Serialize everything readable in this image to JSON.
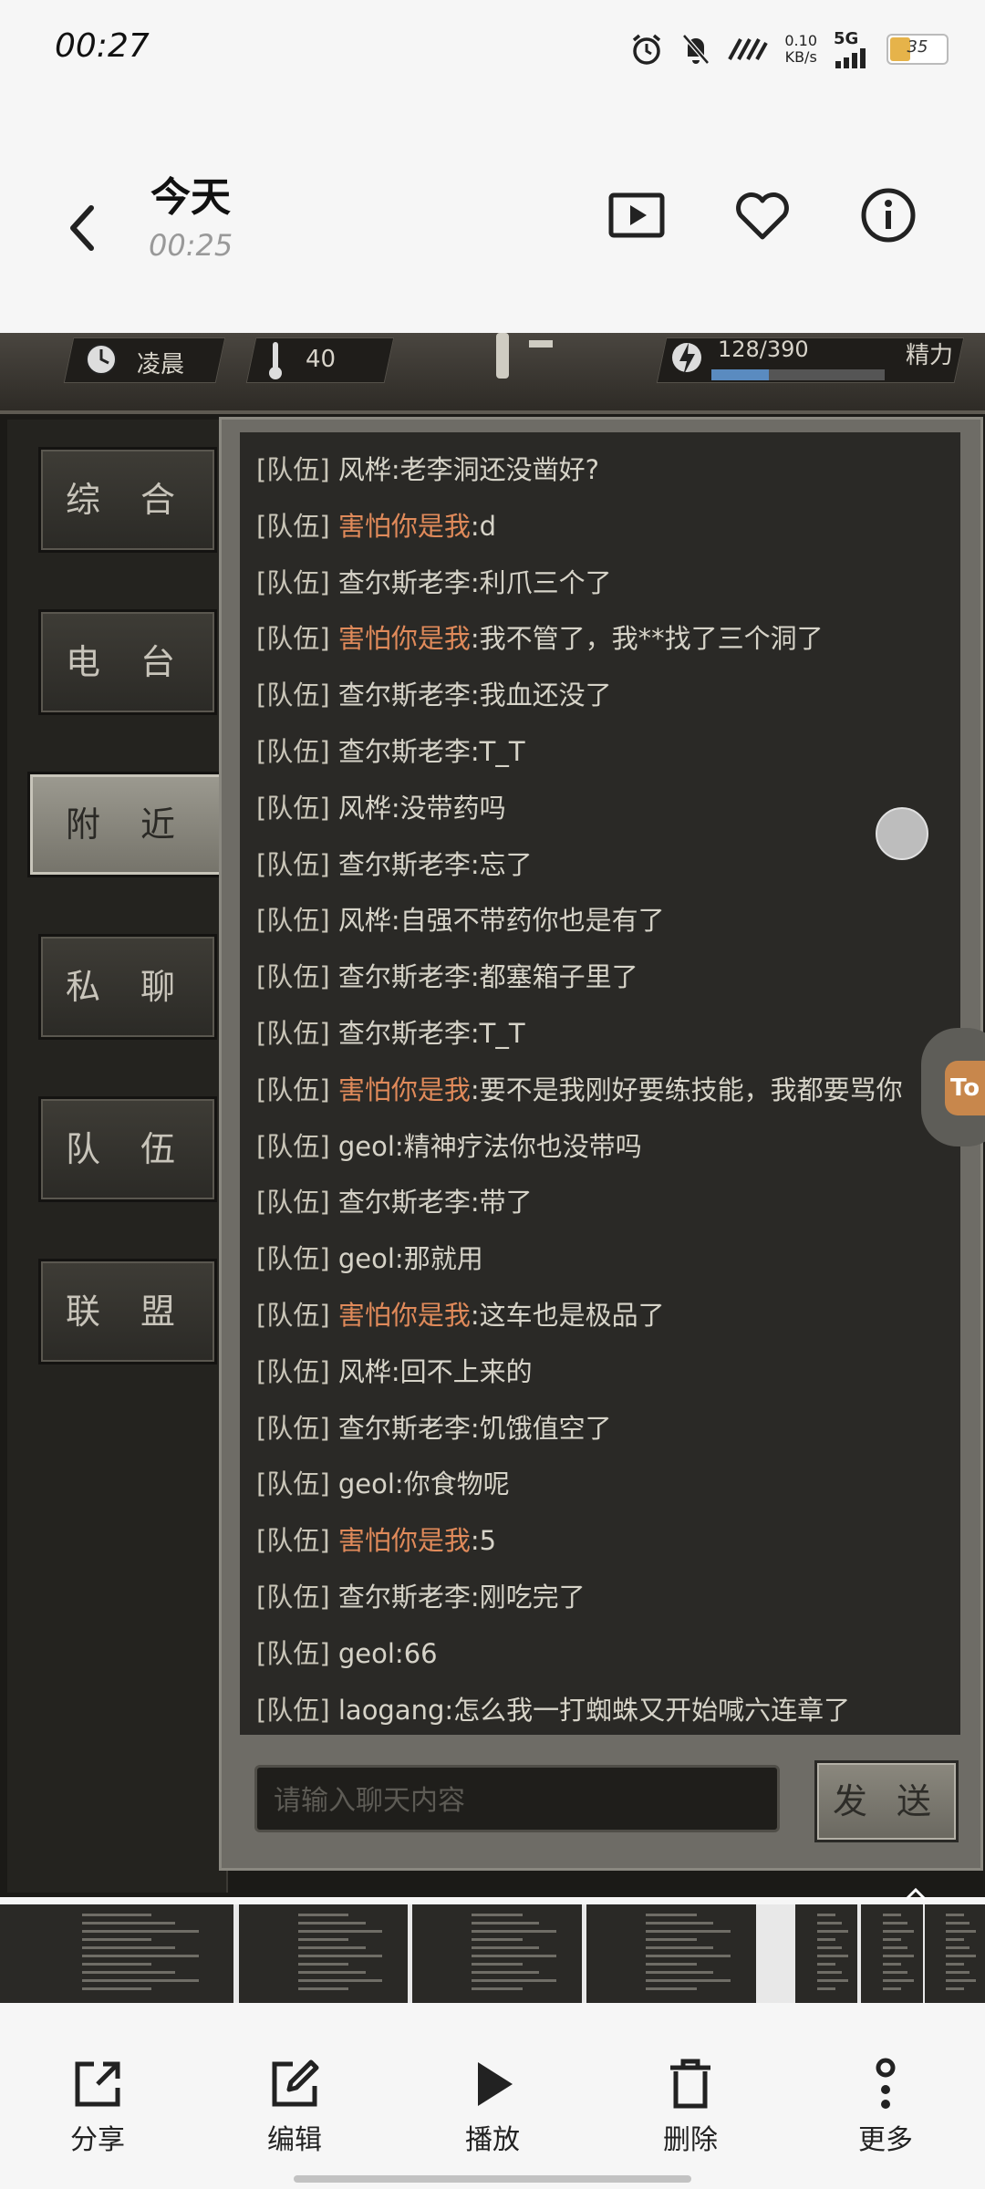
{
  "status_bar": {
    "time": "00:27",
    "net_speed_value": "0.10",
    "net_speed_unit": "KB/s",
    "network": "5G",
    "battery": "35"
  },
  "header": {
    "title": "今天",
    "subtitle": "00:25"
  },
  "game": {
    "time_of_day": "凌晨",
    "temperature": "40",
    "energy_value": "128/390",
    "energy_fraction": 0.33,
    "energy_label": "精力",
    "tabs": [
      "综 合",
      "电 台",
      "附 近",
      "私 聊",
      "队 伍",
      "联 盟"
    ],
    "active_tab": "附 近",
    "chat": [
      {
        "tag": "[队伍]",
        "who": "风桦",
        "orange": false,
        "msg": ":老李洞还没凿好?"
      },
      {
        "tag": "[队伍]",
        "who": "害怕你是我",
        "orange": true,
        "msg": ":d"
      },
      {
        "tag": "[队伍]",
        "who": "查尔斯老李",
        "orange": false,
        "msg": ":利爪三个了"
      },
      {
        "tag": "[队伍]",
        "who": "害怕你是我",
        "orange": true,
        "msg": ":我不管了，我**找了三个洞了"
      },
      {
        "tag": "[队伍]",
        "who": "查尔斯老李",
        "orange": false,
        "msg": ":我血还没了"
      },
      {
        "tag": "[队伍]",
        "who": "查尔斯老李",
        "orange": false,
        "msg": ":T_T"
      },
      {
        "tag": "[队伍]",
        "who": "风桦",
        "orange": false,
        "msg": ":没带药吗"
      },
      {
        "tag": "[队伍]",
        "who": "查尔斯老李",
        "orange": false,
        "msg": ":忘了"
      },
      {
        "tag": "[队伍]",
        "who": "风桦",
        "orange": false,
        "msg": ":自强不带药你也是有了"
      },
      {
        "tag": "[队伍]",
        "who": "查尔斯老李",
        "orange": false,
        "msg": ":都塞箱子里了"
      },
      {
        "tag": "[队伍]",
        "who": "查尔斯老李",
        "orange": false,
        "msg": ":T_T"
      },
      {
        "tag": "[队伍]",
        "who": "害怕你是我",
        "orange": true,
        "msg": ":要不是我刚好要练技能，我都要骂你"
      },
      {
        "tag": "[队伍]",
        "who": "geol",
        "orange": false,
        "msg": ":精神疗法你也没带吗"
      },
      {
        "tag": "[队伍]",
        "who": "查尔斯老李",
        "orange": false,
        "msg": ":带了"
      },
      {
        "tag": "[队伍]",
        "who": "geol",
        "orange": false,
        "msg": ":那就用"
      },
      {
        "tag": "[队伍]",
        "who": "害怕你是我",
        "orange": true,
        "msg": ":这车也是极品了"
      },
      {
        "tag": "[队伍]",
        "who": "风桦",
        "orange": false,
        "msg": ":回不上来的"
      },
      {
        "tag": "[队伍]",
        "who": "查尔斯老李",
        "orange": false,
        "msg": ":饥饿值空了"
      },
      {
        "tag": "[队伍]",
        "who": "geol",
        "orange": false,
        "msg": ":你食物呢"
      },
      {
        "tag": "[队伍]",
        "who": "害怕你是我",
        "orange": true,
        "msg": ":5"
      },
      {
        "tag": "[队伍]",
        "who": "查尔斯老李",
        "orange": false,
        "msg": ":刚吃完了"
      },
      {
        "tag": "[队伍]",
        "who": "geol",
        "orange": false,
        "msg": ":66"
      },
      {
        "tag": "[队伍]",
        "who": "laogang",
        "orange": false,
        "msg": ":怎么我一打蜘蛛又开始喊六连章了"
      }
    ],
    "input_placeholder": "请输入聊天内容",
    "send_label": "发 送",
    "side_widget_text": "To"
  },
  "toolbar": {
    "share": "分享",
    "edit": "编辑",
    "play": "播放",
    "delete": "删除",
    "more": "更多"
  }
}
